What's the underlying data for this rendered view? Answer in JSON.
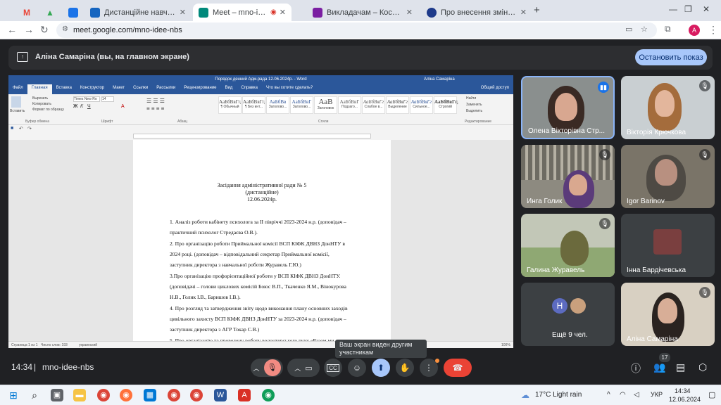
{
  "browser": {
    "tabs": [
      {
        "title": "",
        "color": "#ea4335"
      },
      {
        "title": "",
        "color": "#34a853"
      },
      {
        "title": "",
        "color": "#1a73e8"
      },
      {
        "title": "Дистанційне навчання в ВСП",
        "color": "#1565c0"
      },
      {
        "title": "Meet – mno-idee-nbs",
        "color": "#00897b"
      },
      {
        "title": "Викладачам – Костянтинівськ",
        "color": "#7b1fa2"
      },
      {
        "title": "Про внесення зміни до поста",
        "color": "#1e3a8a"
      }
    ],
    "new_tab": "+",
    "url": "meet.google.com/mno-idee-nbs",
    "profile_initial": "A"
  },
  "banner": {
    "presenter": "Аліна Самаріна (вы, на главном экране)",
    "stop_label": "Остановить показ"
  },
  "word": {
    "title": "Порядок денний Адм.рада 12.06.2024р. - Word",
    "user": "Аліна Самаріна",
    "tabs": [
      "Файл",
      "Главная",
      "Вставка",
      "Конструктор",
      "Макет",
      "Ссылки",
      "Рассылки",
      "Рецензирование",
      "Вид",
      "Справка",
      "Что вы хотите сделать?"
    ],
    "share": "Общий доступ",
    "clipboard": {
      "paste": "Вставить",
      "cut": "Вырезать",
      "copy": "Копировать",
      "format": "Формат по образцу",
      "group": "Буфер обмена"
    },
    "font": {
      "name": "Times New Ro",
      "size": "14",
      "group": "Шрифт"
    },
    "paragraph_group": "Абзац",
    "styles_group": "Стили",
    "styles": [
      {
        "sample": "АаБбВвГг,",
        "name": "¶ Обычный"
      },
      {
        "sample": "АаБбВвГг,",
        "name": "¶ Без инт..."
      },
      {
        "sample": "АаБбВв",
        "name": "Заголово..."
      },
      {
        "sample": "АаБбВвГ",
        "name": "Заголово..."
      },
      {
        "sample": "АаВ",
        "name": "Заголовок"
      },
      {
        "sample": "АаБбВвГ",
        "name": "Подзаго..."
      },
      {
        "sample": "АаБбВвГг",
        "name": "Слабое в..."
      },
      {
        "sample": "АаБбВвГг",
        "name": "Выделение"
      },
      {
        "sample": "АаБбВвГг",
        "name": "Сильное..."
      },
      {
        "sample": "АаБбВвГг,",
        "name": "Строгий"
      }
    ],
    "editing": {
      "find": "Найти",
      "replace": "Заменить",
      "select": "Выделить",
      "group": "Редактирование"
    },
    "status": {
      "page": "Страница 1 из 1",
      "words": "Число слов: 193",
      "lang": "украинский",
      "zoom": "100%"
    },
    "doc": {
      "title1": "Засідання адміністративної ради № 5",
      "title2": "(дистанційне)",
      "date": "12.06.2024р.",
      "lines": [
        "1. Аналіз роботи кабінету психолога за  ІІ півріччі 2023-2024 н.р. (доповідач –",
        "практичний психолог Стредаєва О.В.).",
        "2. Про організацію роботи Приймальної комісії ВСП КІФК ДВНЗ ДонНТУ в",
        "2024 році. (доповідач – відповідальний секретар Приймальної комісії,",
        "заступник директора з навчальної роботи Журавель Г.Ю.)",
        "3.Про організацію профорієнтаційної роботи у ВСП КІФК ДВНЗ ДонНТУ.",
        "(доповідачі – голови циклових комісій Боюс В.П., Ткаченко Я.М., Вінокурова",
        "Н.В., Голик І.В., Баришов І.В.).",
        "4. Про розгляд та затвердження звіту щодо виконання плану основних заходів",
        "цивільного захисту ВСП КІФК ДВНЗ ДонНТУ за  2023-2024 н.р. (доповідач –",
        "заступник директора з АГР Токар С.В.)",
        "5. Про організацію та проведену роботу волонтерського руху «Разом ми"
      ]
    }
  },
  "participants": [
    {
      "name": "Олена Вікторівна Стр...",
      "speaking": true
    },
    {
      "name": "Вікторія Крючкова",
      "muted": true
    },
    {
      "name": "Инга Голик",
      "muted": true
    },
    {
      "name": "Igor Barinov",
      "muted": true
    },
    {
      "name": "Галина Журавель",
      "muted": true
    },
    {
      "name": "Інна Бардічевська",
      "muted": false
    },
    {
      "name": "Ещё 9 чел.",
      "initial": "Н"
    },
    {
      "name": "Аліна Самаріна",
      "muted": true
    }
  ],
  "meeting": {
    "time": "14:34",
    "code": "mno-idee-nbs",
    "tooltip": "Ваш экран виден другим участникам",
    "people_count": "17"
  },
  "taskbar": {
    "weather": "17°C  Light rain",
    "lang": "УКР",
    "time": "14:34",
    "date": "12.06.2024"
  }
}
